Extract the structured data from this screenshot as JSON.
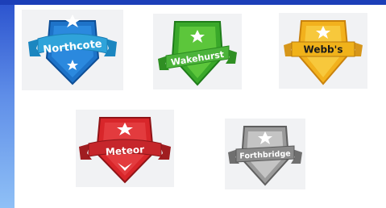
{
  "badges": [
    {
      "label": "Northcote",
      "colors": {
        "primary": "#1e73c8",
        "ribbon": "#2f9fd6",
        "star": "#ffffff"
      }
    },
    {
      "label": "Wakehurst",
      "colors": {
        "primary": "#3aa82a",
        "ribbon": "#4bb33a",
        "star": "#ffffff"
      }
    },
    {
      "label": "Webb's",
      "colors": {
        "primary": "#f2b11d",
        "ribbon": "#f0b21a",
        "star": "#ffffff"
      }
    },
    {
      "label": "Meteor",
      "colors": {
        "primary": "#d8262a",
        "ribbon": "#c6262b",
        "star": "#ffffff"
      }
    },
    {
      "label": "Forthbridge",
      "colors": {
        "primary": "#9a9a9a",
        "ribbon": "#8a8a8a",
        "star": "#ffffff"
      }
    }
  ],
  "theme": {
    "top_bar": "#1c3fb8",
    "side_bar": "#5f8ee8"
  }
}
